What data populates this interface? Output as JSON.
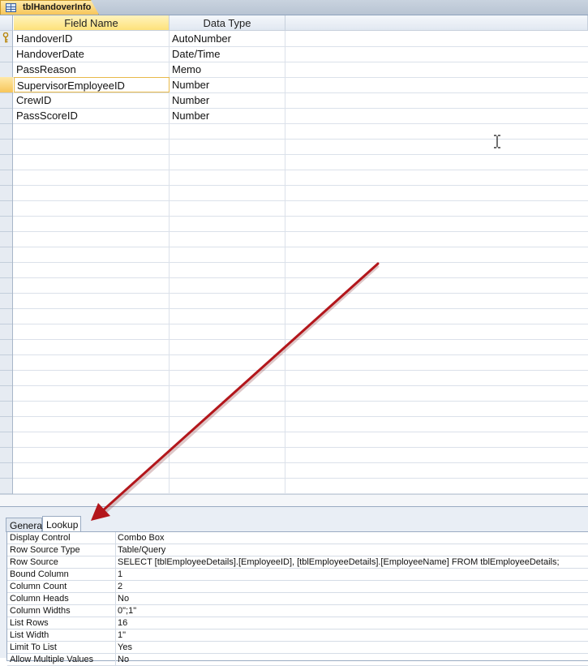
{
  "document_tab": {
    "label": "tblHandoverInfo",
    "icon": "table-icon"
  },
  "grid": {
    "headers": {
      "field_name": "Field Name",
      "data_type": "Data Type",
      "description": ""
    },
    "rows": [
      {
        "field_name": "HandoverID",
        "data_type": "AutoNumber",
        "primary_key": true
      },
      {
        "field_name": "HandoverDate",
        "data_type": "Date/Time"
      },
      {
        "field_name": "PassReason",
        "data_type": "Memo"
      },
      {
        "field_name": "SupervisorEmployeeID",
        "data_type": "Number",
        "selected": true
      },
      {
        "field_name": "CrewID",
        "data_type": "Number"
      },
      {
        "field_name": "PassScoreID",
        "data_type": "Number"
      }
    ]
  },
  "field_properties": {
    "tabs": [
      {
        "label": "General",
        "active": false
      },
      {
        "label": "Lookup",
        "active": true
      }
    ],
    "properties": [
      {
        "name": "Display Control",
        "value": "Combo Box"
      },
      {
        "name": "Row Source Type",
        "value": "Table/Query"
      },
      {
        "name": "Row Source",
        "value": "SELECT [tblEmployeeDetails].[EmployeeID], [tblEmployeeDetails].[EmployeeName] FROM tblEmployeeDetails;"
      },
      {
        "name": "Bound Column",
        "value": "1"
      },
      {
        "name": "Column Count",
        "value": "2"
      },
      {
        "name": "Column Heads",
        "value": "No"
      },
      {
        "name": "Column Widths",
        "value": "0\";1\""
      },
      {
        "name": "List Rows",
        "value": "16"
      },
      {
        "name": "List Width",
        "value": "1\""
      },
      {
        "name": "Limit To List",
        "value": "Yes"
      },
      {
        "name": "Allow Multiple Values",
        "value": "No"
      }
    ]
  },
  "colors": {
    "active_header": "#fde27b",
    "selection_border": "#e8b94a",
    "annotation_arrow": "#b3161b"
  }
}
